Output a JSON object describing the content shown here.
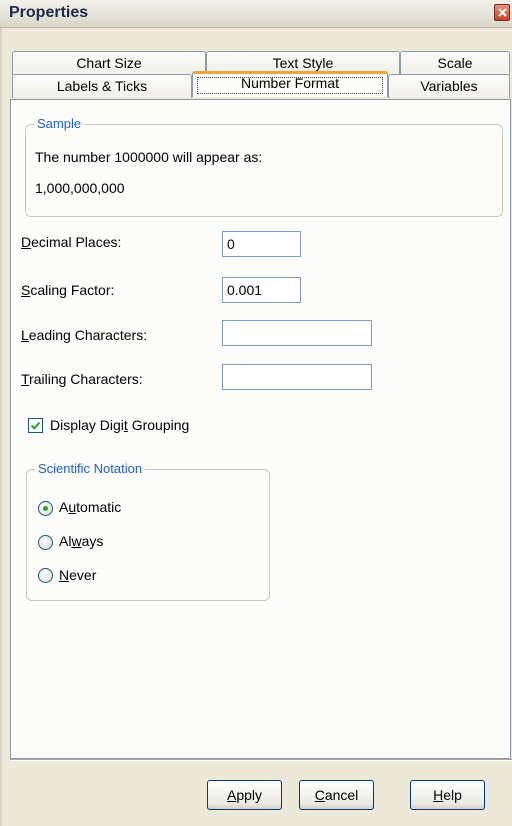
{
  "window": {
    "title": "Properties",
    "close_icon": "close-icon"
  },
  "tabs": {
    "row1": [
      {
        "label": "Chart Size"
      },
      {
        "label": "Text Style"
      },
      {
        "label": "Scale"
      }
    ],
    "row2": [
      {
        "label": "Labels & Ticks"
      },
      {
        "label": "Number Format",
        "active": true
      },
      {
        "label": "Variables"
      }
    ]
  },
  "sample": {
    "legend": "Sample",
    "description": "The number 1000000 will appear as:",
    "result": "1,000,000,000"
  },
  "fields": {
    "decimal_places": {
      "label": "Decimal Places:",
      "value": "0"
    },
    "scaling_factor": {
      "label": "Scaling Factor:",
      "value": "0.001"
    },
    "leading_characters": {
      "label": "Leading Characters:",
      "value": ""
    },
    "trailing_characters": {
      "label": "Trailing Characters:",
      "value": ""
    }
  },
  "digit_grouping": {
    "label": "Display Digit Grouping",
    "checked": true
  },
  "scientific_notation": {
    "legend": "Scientific Notation",
    "options": [
      {
        "label": "Automatic",
        "selected": true
      },
      {
        "label": "Always",
        "selected": false
      },
      {
        "label": "Never",
        "selected": false
      }
    ]
  },
  "buttons": {
    "apply": "Apply",
    "cancel": "Cancel",
    "help": "Help"
  },
  "colors": {
    "accent": "#f2a33a",
    "legend_text": "#1d5fd0",
    "radio_selected": "#28a020"
  }
}
